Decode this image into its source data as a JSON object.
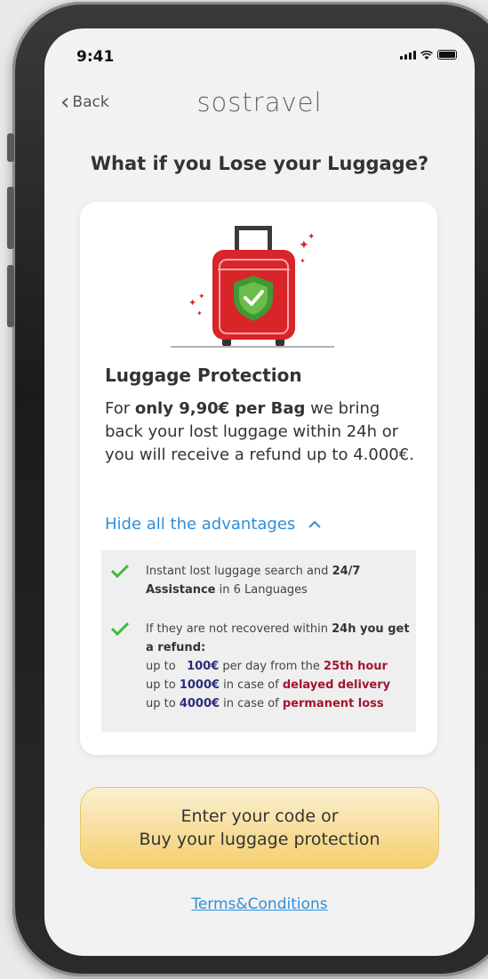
{
  "status_bar": {
    "time": "9:41"
  },
  "nav": {
    "back_label": "Back",
    "logo": "sostravel"
  },
  "page_title": "What if you Lose your Luggage?",
  "protection": {
    "title": "Luggage Protection",
    "text_pre": "For ",
    "text_bold": "only 9,90€ per Bag",
    "text_post": " we bring back your lost luggage within 24h or you will receive a refund up to 4.000€."
  },
  "advantages_toggle": "Hide all the advantages",
  "advantages": {
    "item1": {
      "pre": "Instant lost luggage search and ",
      "bold": "24/7 Assistance",
      "post": " in 6 Languages"
    },
    "item2": {
      "line1_pre": "If they are not recovered within ",
      "line1_bold": "24h you get a refund:",
      "row1_pre": "up to ",
      "row1_amount": "100€",
      "row1_mid": " per day from the ",
      "row1_red": "25th hour",
      "row2_pre": "up to ",
      "row2_amount": "1000€",
      "row2_mid": " in case of ",
      "row2_red": "delayed delivery",
      "row3_pre": "up to ",
      "row3_amount": "4000€",
      "row3_mid": " in case of ",
      "row3_red": "permanent loss"
    }
  },
  "cta": {
    "line1": "Enter your code or",
    "line2": "Buy your luggage protection"
  },
  "terms_link": "Terms&Conditions",
  "colors": {
    "accent_blue": "#2e8fd8",
    "suitcase_red": "#d9252a",
    "shield_green": "#5bb343",
    "cta_gold": "#f5cf6e",
    "navy": "#2a2e7d",
    "crimson": "#a3142f"
  }
}
